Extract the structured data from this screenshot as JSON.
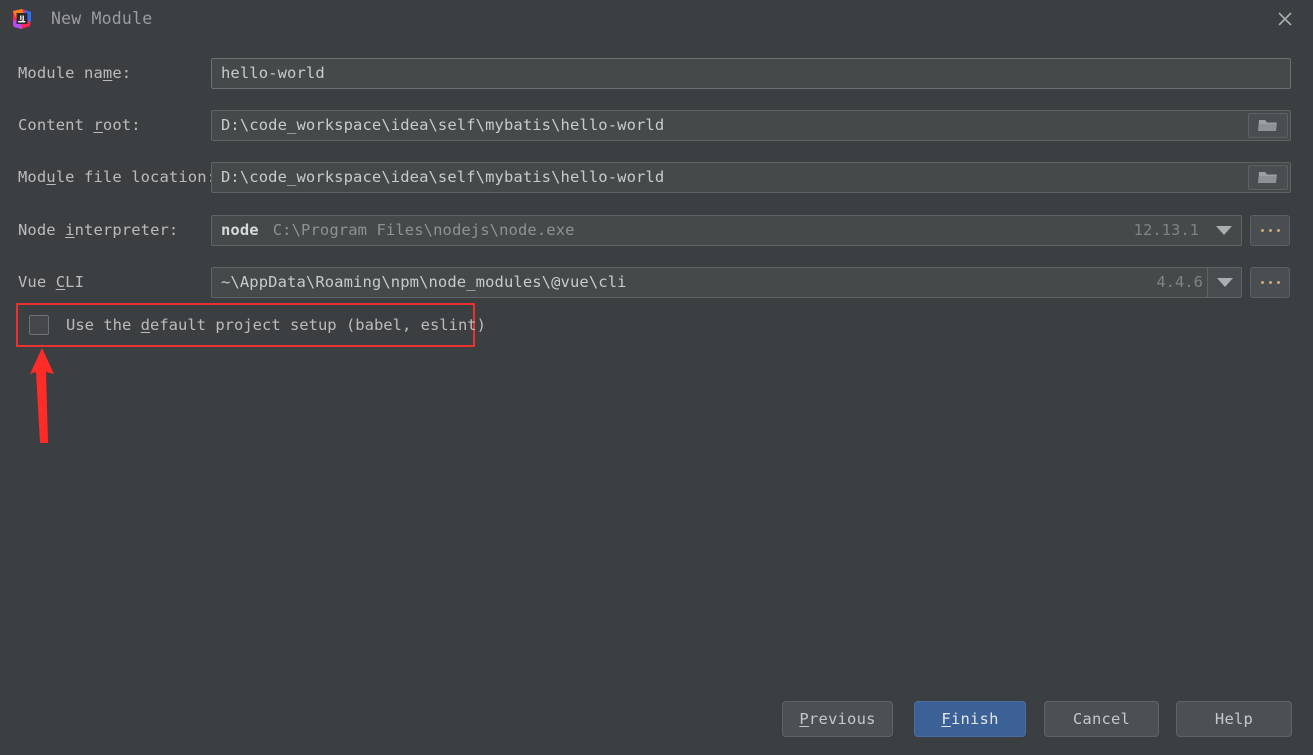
{
  "window": {
    "title": "New Module",
    "app_icon": "intellij-idea-icon",
    "close_icon": "close-icon",
    "background_color": "#3c3f41"
  },
  "form": {
    "fields": [
      {
        "label_prefix": "Module na",
        "label_mnemonic": "m",
        "label_suffix": "e:",
        "value": "hello-world",
        "has_folder_button": false,
        "has_dropdown": false,
        "has_browse_dots": false
      },
      {
        "label_prefix": "Content ",
        "label_mnemonic": "r",
        "label_suffix": "oot:",
        "value": "D:\\code_workspace\\idea\\self\\mybatis\\hello-world",
        "has_folder_button": true,
        "folder_icon": "folder-icon",
        "has_dropdown": false,
        "has_browse_dots": false
      },
      {
        "label_prefix": "Mod",
        "label_mnemonic": "u",
        "label_suffix": "le file location:",
        "value": "D:\\code_workspace\\idea\\self\\mybatis\\hello-world",
        "has_folder_button": true,
        "folder_icon": "folder-icon",
        "has_dropdown": false,
        "has_browse_dots": false
      },
      {
        "label_prefix": "Node ",
        "label_mnemonic": "i",
        "label_suffix": "nterpreter:",
        "value_strong": "node",
        "value": "C:\\Program Files\\nodejs\\node.exe",
        "version": "12.13.1",
        "has_folder_button": false,
        "has_dropdown": true,
        "dropdown_icon": "chevron-down-icon",
        "has_browse_dots": true,
        "browse_icon": "ellipsis-icon"
      },
      {
        "label_prefix": "Vue ",
        "label_mnemonic": "C",
        "label_suffix": "LI",
        "value": "~\\AppData\\Roaming\\npm\\node_modules\\@vue\\cli",
        "version": "4.4.6",
        "has_folder_button": false,
        "has_dropdown": true,
        "dropdown_icon": "chevron-down-icon",
        "has_browse_dots": true,
        "browse_icon": "ellipsis-icon"
      }
    ]
  },
  "checkbox": {
    "checked": false,
    "label_prefix": "Use the ",
    "label_mnemonic": "d",
    "label_suffix": "efault project setup (babel, eslint)",
    "highlight_color": "#e8322e"
  },
  "annotation": {
    "arrow": "red-up-arrow",
    "color": "#ff2b26"
  },
  "buttons": [
    {
      "prefix": "",
      "mnemonic": "P",
      "suffix": "revious",
      "primary": false
    },
    {
      "prefix": "",
      "mnemonic": "F",
      "suffix": "inish",
      "primary": true
    },
    {
      "prefix": "Cancel",
      "mnemonic": "",
      "suffix": "",
      "primary": false
    },
    {
      "prefix": "Help",
      "mnemonic": "",
      "suffix": "",
      "primary": false
    }
  ]
}
